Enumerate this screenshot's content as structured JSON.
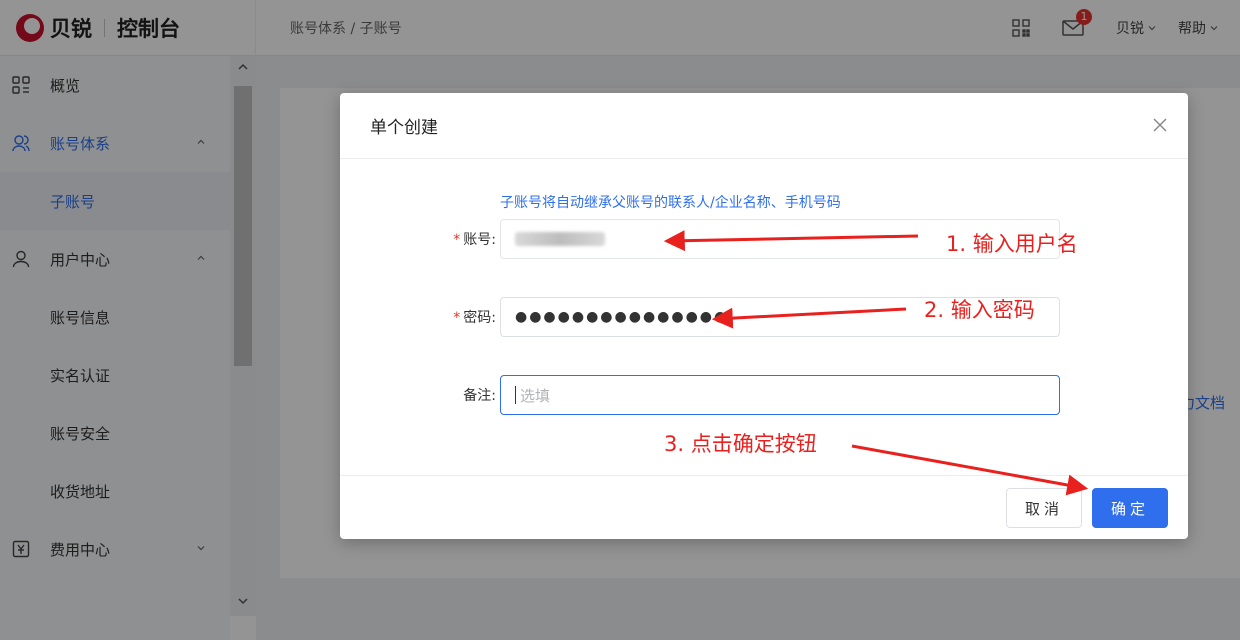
{
  "header": {
    "brand_name": "贝锐",
    "brand_console": "控制台",
    "breadcrumb": "账号体系 / 子账号",
    "mail_badge": "1",
    "user_menu": "贝锐",
    "help_menu": "帮助"
  },
  "sidebar": {
    "items": [
      {
        "label": "概览",
        "icon": "grid-icon"
      },
      {
        "label": "账号体系",
        "icon": "users-icon",
        "expanded": true
      },
      {
        "label": "子账号",
        "selected": true
      },
      {
        "label": "用户中心",
        "icon": "user-icon",
        "expanded": true
      },
      {
        "label": "账号信息"
      },
      {
        "label": "实名认证"
      },
      {
        "label": "账号安全"
      },
      {
        "label": "收货地址"
      },
      {
        "label": "费用中心",
        "icon": "yen-icon",
        "expanded": false
      }
    ]
  },
  "background": {
    "peek_link": "力文档"
  },
  "modal": {
    "title": "单个创建",
    "notice": "子账号将自动继承父账号的联系人/企业名称、手机号码",
    "fields": {
      "account_label": "账号:",
      "password_label": "密码:",
      "password_value": "●●●●●●●●●●●●●●●",
      "note_label": "备注:",
      "note_placeholder": "选填"
    },
    "cancel_label": "取消",
    "ok_label": "确定"
  },
  "annotations": {
    "step1": "1. 输入用户名",
    "step2": "2. 输入密码",
    "step3": "3. 点击确定按钮",
    "color": "#e8211e"
  },
  "colors": {
    "accent": "#2f6fed",
    "required": "#e8322d",
    "brand": "#c8102e"
  }
}
